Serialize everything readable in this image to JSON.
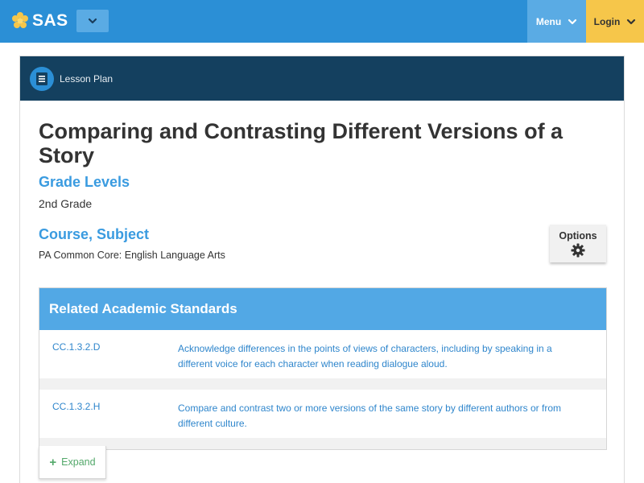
{
  "header": {
    "logo_text": "SAS",
    "menu_label": "Menu",
    "login_label": "Login",
    "colors": {
      "bar": "#2b8fd6",
      "menu": "#5aabe4",
      "login": "#f6c64a"
    }
  },
  "card": {
    "type_label": "Lesson Plan",
    "type_icon": "document-icon",
    "title": "Comparing and Contrasting Different Versions of a Story",
    "grade_heading": "Grade Levels",
    "grade_value": "2nd Grade",
    "course_heading": "Course, Subject",
    "course_value": "PA Common Core: English Language Arts",
    "options_label": "Options",
    "options_icon": "gear-icon"
  },
  "standards": {
    "heading": "Related Academic Standards",
    "rows": [
      {
        "code": "CC.1.3.2.D",
        "description": "Acknowledge differences in the points of views of characters, including by speaking in a different voice for each character when reading dialogue aloud."
      },
      {
        "code": "CC.1.3.2.H",
        "description": "Compare and contrast two or more versions of the same story by different authors or from different culture."
      }
    ],
    "expand_label": "Expand"
  }
}
